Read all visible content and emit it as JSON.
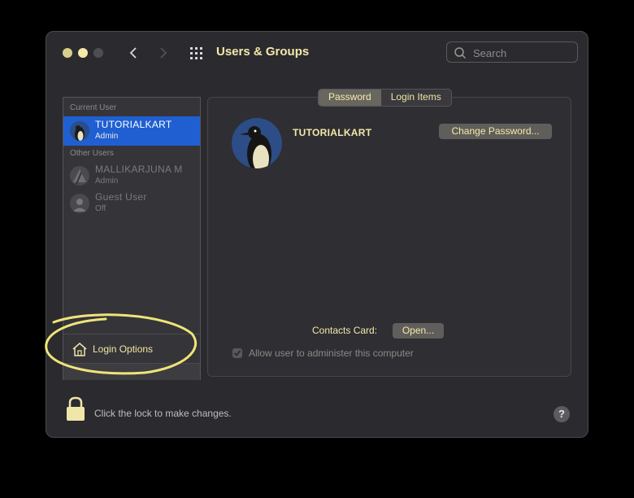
{
  "window": {
    "title": "Users & Groups"
  },
  "search": {
    "placeholder": "Search"
  },
  "sidebar": {
    "current_user_label": "Current User",
    "other_users_label": "Other Users",
    "current_user": {
      "name": "TUTORIALKART",
      "role": "Admin"
    },
    "other_users": [
      {
        "name": "MALLIKARJUNA M",
        "role": "Admin"
      },
      {
        "name": "Guest User",
        "role": "Off"
      }
    ],
    "login_options_label": "Login Options"
  },
  "tabs": [
    {
      "label": "Password",
      "active": true
    },
    {
      "label": "Login Items",
      "active": false
    }
  ],
  "account": {
    "name": "TUTORIALKART",
    "change_password_label": "Change Password...",
    "contacts_card_label": "Contacts Card:",
    "open_label": "Open...",
    "allow_admin_label": "Allow user to administer this computer",
    "allow_admin_checked": true
  },
  "footer": {
    "lock_text": "Click the lock to make changes.",
    "help_label": "?"
  },
  "colors": {
    "accent": "#f3e9a9",
    "selection": "#1f5fd1",
    "annotation": "#efe47a"
  }
}
